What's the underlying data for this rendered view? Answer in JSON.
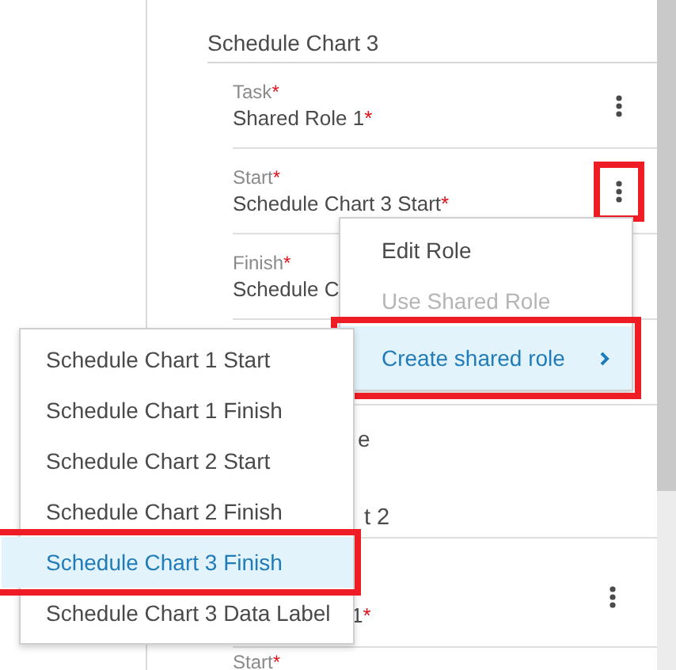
{
  "panel": {
    "title": "Schedule Chart 3",
    "rows": [
      {
        "kind": "field",
        "label": "Task",
        "label_mark": "*",
        "value": "Shared Role 1",
        "value_mark": "*",
        "menu_callout": false
      },
      {
        "kind": "field",
        "label": "Start",
        "label_mark": "*",
        "value": "Schedule Chart 3 Start",
        "value_mark": "*",
        "menu_callout": true
      },
      {
        "kind": "field_no_menu",
        "label": "Finish",
        "label_mark": "*",
        "value": "Schedule C"
      },
      {
        "kind": "covered"
      },
      {
        "kind": "fragment",
        "text": "e"
      },
      {
        "kind": "fragment_end",
        "text": "t 2"
      },
      {
        "kind": "fragment_field",
        "value": "1",
        "value_mark": "*",
        "menu_callout": false
      },
      {
        "kind": "label_only",
        "label": "Start",
        "label_mark": "*"
      }
    ]
  },
  "context_menu": {
    "items": [
      {
        "label": "Edit Role",
        "disabled": false,
        "selected": false,
        "submenu": false,
        "callout": false
      },
      {
        "label": "Use Shared Role",
        "disabled": true,
        "selected": false,
        "submenu": false,
        "callout": false
      },
      {
        "label": "Create shared role",
        "disabled": false,
        "selected": true,
        "submenu": true,
        "callout": true
      }
    ]
  },
  "submenu": {
    "items": [
      {
        "label": "Schedule Chart 1 Start",
        "selected": false,
        "callout": false
      },
      {
        "label": "Schedule Chart 1 Finish",
        "selected": false,
        "callout": false
      },
      {
        "label": "Schedule Chart 2 Start",
        "selected": false,
        "callout": false
      },
      {
        "label": "Schedule Chart 2 Finish",
        "selected": false,
        "callout": false
      },
      {
        "label": "Schedule Chart 3 Finish",
        "selected": true,
        "callout": true
      },
      {
        "label": "Schedule Chart 3 Data Label",
        "selected": false,
        "callout": false
      }
    ]
  }
}
